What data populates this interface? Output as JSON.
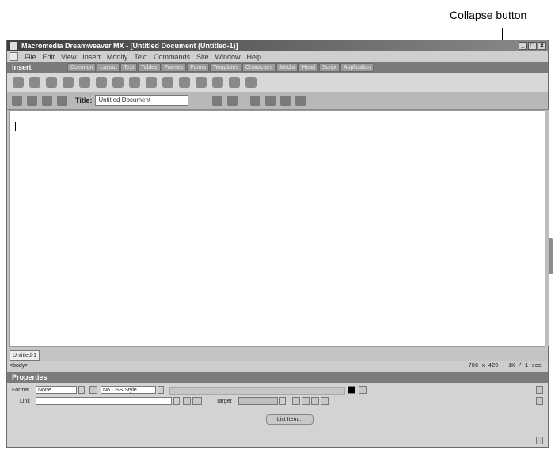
{
  "callout": {
    "label": "Collapse button"
  },
  "window": {
    "title": "Macromedia Dreamweaver MX - [Untitled Document (Untitled-1)]",
    "menu": [
      "File",
      "Edit",
      "View",
      "Insert",
      "Modify",
      "Text",
      "Commands",
      "Site",
      "Window",
      "Help"
    ]
  },
  "insert_panel": {
    "title": "Insert",
    "tabs": [
      "Common",
      "Layout",
      "Text",
      "Tables",
      "Frames",
      "Forms",
      "Templates",
      "Characters",
      "Media",
      "Head",
      "Script",
      "Application"
    ]
  },
  "doc_toolbar": {
    "title_label": "Title:",
    "title_value": "Untitled Document"
  },
  "document": {
    "tab_label": "Untitled-1"
  },
  "status": {
    "tag": "<body>",
    "info": "786 x 429 - 1K / 1 sec"
  },
  "properties": {
    "title": "Properties",
    "format_label": "Format",
    "format_value": "None",
    "style_value": "No CSS Style",
    "link_label": "Link",
    "target_label": "Target",
    "page_button": "List Item..."
  }
}
